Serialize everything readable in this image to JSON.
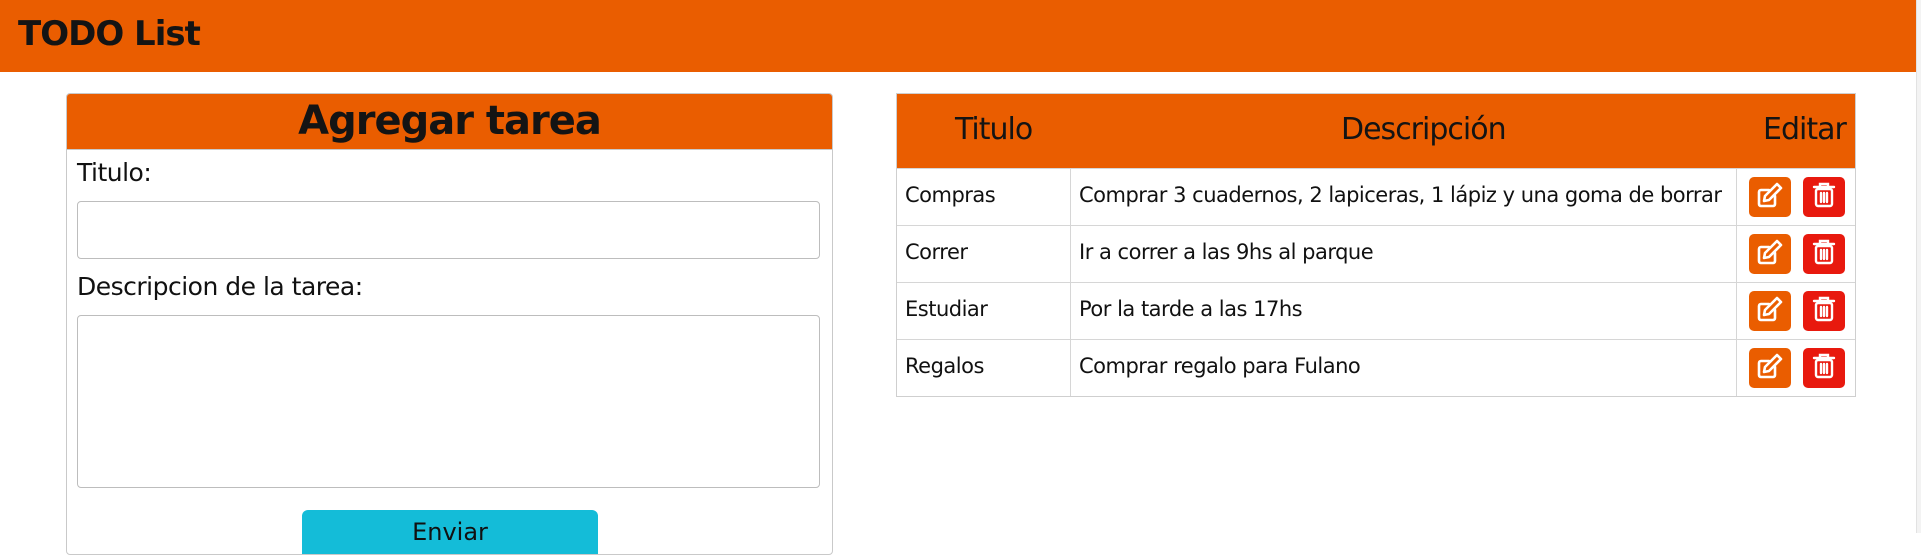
{
  "app": {
    "title": "TODO List"
  },
  "form": {
    "header": "Agregar tarea",
    "title_label": "Titulo:",
    "title_value": "",
    "description_label": "Descripcion de la tarea:",
    "description_value": "",
    "submit_label": "Enviar"
  },
  "table": {
    "columns": [
      "Titulo",
      "Descripción",
      "Editar"
    ],
    "rows": [
      {
        "title": "Compras",
        "description": "Comprar 3 cuadernos, 2 lapiceras, 1 lápiz y una goma de borrar"
      },
      {
        "title": "Correr",
        "description": "Ir a correr a las 9hs al parque"
      },
      {
        "title": "Estudiar",
        "description": "Por la tarde a las 17hs"
      },
      {
        "title": "Regalos",
        "description": "Comprar regalo para Fulano"
      }
    ]
  },
  "icons": {
    "edit": "edit-icon",
    "delete": "trash-icon"
  },
  "colors": {
    "primary": "#ea5d00",
    "danger": "#e8190e",
    "submit": "#14bcd8"
  }
}
